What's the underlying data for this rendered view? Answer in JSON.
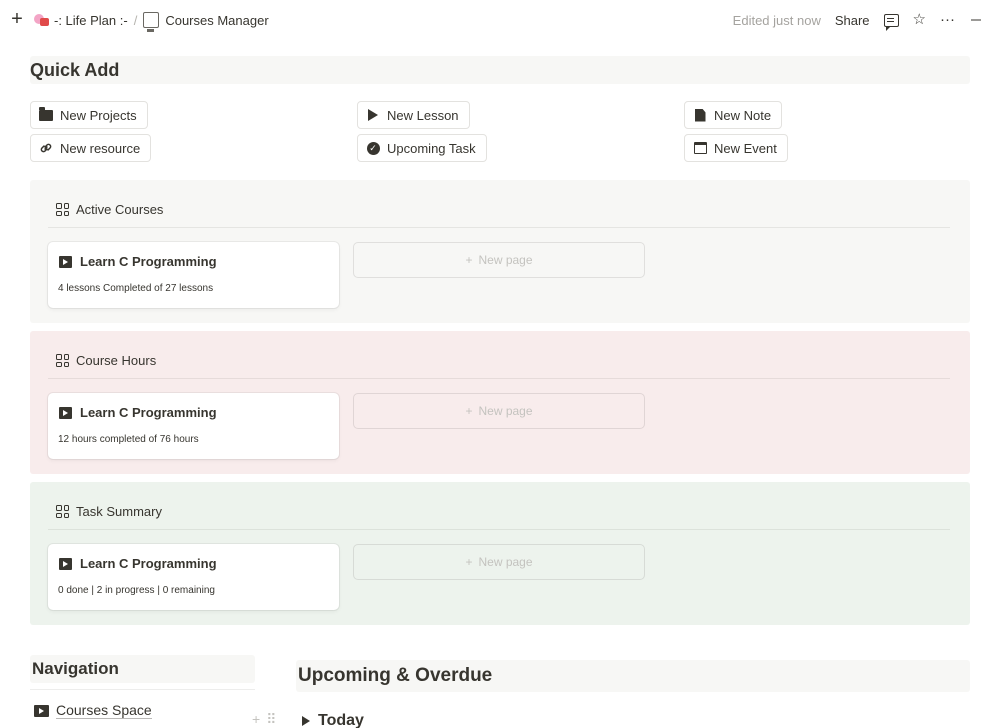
{
  "topbar": {
    "breadcrumb": [
      {
        "label": "-: Life Plan :-",
        "icon": "life-plan-emoji-icon"
      },
      {
        "label": "Courses Manager",
        "icon": "computer-emoji-icon"
      }
    ],
    "separator": "/",
    "edited": "Edited just now",
    "share": "Share",
    "more": "···"
  },
  "quick_add": {
    "title": "Quick Add",
    "buttons": [
      {
        "label": "New Projects",
        "icon": "folder-icon"
      },
      {
        "label": "New Lesson",
        "icon": "play-icon"
      },
      {
        "label": "New Note",
        "icon": "document-icon"
      },
      {
        "label": "New resource",
        "icon": "link-icon"
      },
      {
        "label": "Upcoming Task",
        "icon": "check-circle-icon"
      },
      {
        "label": "New Event",
        "icon": "calendar-icon"
      }
    ]
  },
  "sections": [
    {
      "title": "Active Courses",
      "bg": "#f7f7f5",
      "card": {
        "title": "Learn C Programming",
        "subtitle": "4 lessons Completed of 27 lessons"
      },
      "new_page": "New page"
    },
    {
      "title": "Course Hours",
      "bg": "#f8ecec",
      "card": {
        "title": "Learn C Programming",
        "subtitle": "12 hours completed of 76 hours"
      },
      "new_page": "New page"
    },
    {
      "title": "Task Summary",
      "bg": "#edf3ed",
      "card": {
        "title": "Learn C Programming",
        "subtitle": "0 done | 2 in progress | 0 remaining"
      },
      "new_page": "New page"
    }
  ],
  "navigation": {
    "title": "Navigation",
    "items": [
      {
        "label": "Courses Space",
        "icon": "screen-play-icon"
      }
    ]
  },
  "upcoming": {
    "title": "Upcoming & Overdue",
    "groups": [
      {
        "label": "Today"
      }
    ]
  }
}
